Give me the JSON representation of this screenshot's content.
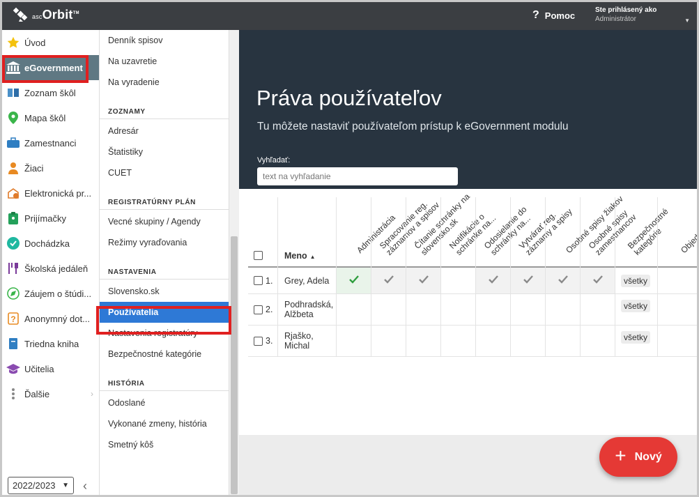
{
  "topbar": {
    "logo_text": "Orbit",
    "logo_prefix": "asc",
    "help_label": "Pomoc",
    "user_line1": "Ste prihlásený ako",
    "user_line2": "Administrátor"
  },
  "sidebar": {
    "items": [
      {
        "label": "Úvod",
        "icon": "star-icon"
      },
      {
        "label": "eGovernment",
        "icon": "government-building-icon"
      },
      {
        "label": "Zoznam škôl",
        "icon": "book-icon"
      },
      {
        "label": "Mapa škôl",
        "icon": "map-pin-icon"
      },
      {
        "label": "Zamestnanci",
        "icon": "briefcase-icon"
      },
      {
        "label": "Žiaci",
        "icon": "student-icon"
      },
      {
        "label": "Elektronická pr...",
        "icon": "school-apply-icon"
      },
      {
        "label": "Prijímačky",
        "icon": "clipboard-icon"
      },
      {
        "label": "Dochádzka",
        "icon": "check-circle-icon"
      },
      {
        "label": "Školská jedáleň",
        "icon": "cutlery-icon"
      },
      {
        "label": "Záujem o štúdi...",
        "icon": "compass-icon"
      },
      {
        "label": "Anonymný dot...",
        "icon": "question-box-icon"
      },
      {
        "label": "Triedna kniha",
        "icon": "notebook-icon"
      },
      {
        "label": "Učitelia",
        "icon": "graduation-cap-icon"
      },
      {
        "label": "Ďalšie",
        "icon": "more-dots-icon"
      }
    ],
    "school_year": "2022/2023"
  },
  "submenu": {
    "top_items": [
      "Denník spisov",
      "Na uzavretie",
      "Na vyradenie"
    ],
    "sections": [
      {
        "title": "ZOZNAMY",
        "items": [
          "Adresár",
          "Štatistiky",
          "CUET"
        ]
      },
      {
        "title": "REGISTRATÚRNY PLÁN",
        "items": [
          "Vecné skupiny / Agendy",
          "Režimy vyraďovania"
        ]
      },
      {
        "title": "NASTAVENIA",
        "items": [
          "Slovensko.sk",
          "Používatelia",
          "Nastavenia registratúry",
          "Bezpečnostné kategórie"
        ]
      },
      {
        "title": "HISTÓRIA",
        "items": [
          "Odoslané",
          "Vykonané zmeny, história",
          "Smetný kôš"
        ]
      }
    ]
  },
  "main": {
    "title": "Práva používateľov",
    "subtitle": "Tu môžete nastaviť používateľom prístup k eGovernment modulu",
    "search_label": "Vyhľadať:",
    "search_placeholder": "text na vyhľadanie",
    "name_header": "Meno",
    "columns": [
      {
        "line1": "Administrácia",
        "line2": ""
      },
      {
        "line1": "Spracovanie reg.",
        "line2": "záznamov a spisov"
      },
      {
        "line1": "Čítanie schránky na",
        "line2": "slovensko.sk"
      },
      {
        "line1": "Notifikácie o",
        "line2": "schránke na..."
      },
      {
        "line1": "Odosielanie do",
        "line2": "schránky na..."
      },
      {
        "line1": "Vytvárať reg.",
        "line2": "záznamy a spisy"
      },
      {
        "line1": "Osobné spisy žiakov",
        "line2": ""
      },
      {
        "line1": "Osobné spisy",
        "line2": "zamestnancov"
      },
      {
        "line1": "Bezpečnostné",
        "line2": "kategórie"
      },
      {
        "line1": "Objed",
        "line2": ""
      }
    ],
    "rows": [
      {
        "index": "1.",
        "name_line1": "Grey, Adela",
        "name_line2": "",
        "perms": [
          "granted",
          "ro",
          "ro",
          "",
          "ro",
          "ro",
          "ro",
          "ro"
        ],
        "category": "všetky"
      },
      {
        "index": "2.",
        "name_line1": "Podhradská,",
        "name_line2": "Alžbeta",
        "perms": [
          "",
          "",
          "",
          "",
          "",
          "",
          "",
          ""
        ],
        "category": "všetky"
      },
      {
        "index": "3.",
        "name_line1": "Rjaško,",
        "name_line2": "Michal",
        "perms": [
          "",
          "",
          "",
          "",
          "",
          "",
          "",
          ""
        ],
        "category": "všetky"
      }
    ],
    "new_button": "Nový"
  },
  "colors": {
    "topbar": "#3b3e42",
    "hero": "#283440",
    "active_sidebar": "#5f7883",
    "active_submenu": "#2e79d6",
    "fab": "#e53935",
    "highlight_box": "#e02020",
    "granted_check": "#2e9e3e"
  }
}
